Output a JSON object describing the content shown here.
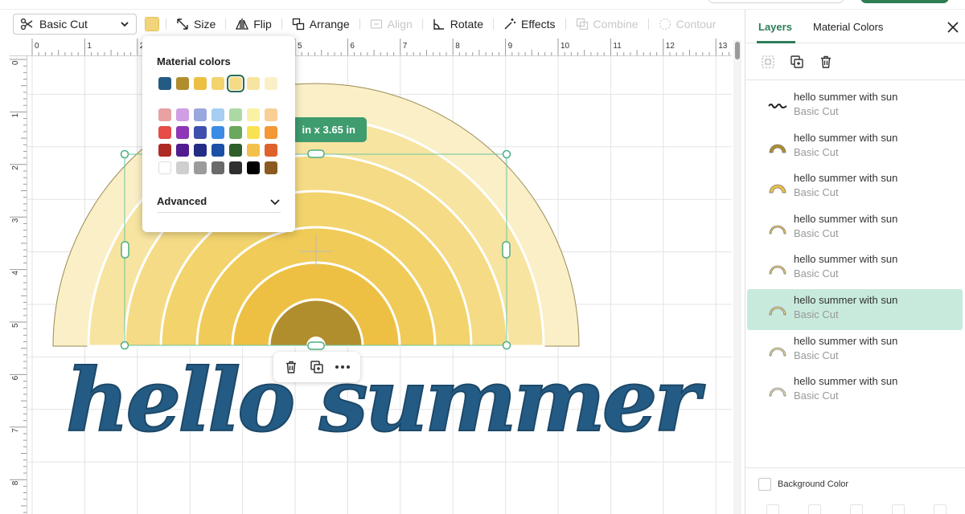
{
  "toolbar": {
    "operation": "Basic Cut",
    "fill_color": "#f2d57a",
    "tools": [
      {
        "label": "Size",
        "icon": "resize-arrows-icon",
        "enabled": true
      },
      {
        "label": "Flip",
        "icon": "flip-icon",
        "enabled": true
      },
      {
        "label": "Arrange",
        "icon": "arrange-icon",
        "enabled": true
      },
      {
        "label": "Align",
        "icon": "align-icon",
        "enabled": false
      },
      {
        "label": "Rotate",
        "icon": "rotate-icon",
        "enabled": true
      },
      {
        "label": "Effects",
        "icon": "magic-wand-icon",
        "enabled": true
      },
      {
        "label": "Combine",
        "icon": "combine-icon",
        "enabled": false
      },
      {
        "label": "Contour",
        "icon": "contour-icon",
        "enabled": false
      }
    ]
  },
  "ruler": {
    "top": [
      "0",
      "1",
      "2",
      "3",
      "4",
      "5",
      "6",
      "7",
      "8",
      "9",
      "10",
      "11",
      "12",
      "13"
    ],
    "left": [
      "0",
      "1",
      "2",
      "3",
      "4",
      "5",
      "6",
      "7",
      "8"
    ]
  },
  "selection": {
    "size_label": "in x 3.65  in"
  },
  "canvas": {
    "text": "hello summer",
    "text_color": "#245b84",
    "arc_colors": [
      "#faefc7",
      "#f7e4a0",
      "#f5db85",
      "#f2d36c",
      "#f0cb58",
      "#edc044",
      "#b18e2d"
    ]
  },
  "color_popover": {
    "title": "Material colors",
    "material_swatches": [
      "#245b84",
      "#b18e2d",
      "#edc044",
      "#f2d36c",
      "#f5db85",
      "#f7e4a0",
      "#faefc7"
    ],
    "selected_index": 4,
    "basic_swatches": [
      "#e8a2a2",
      "#d19ee4",
      "#9aa6de",
      "#a6cdf2",
      "#acd8a4",
      "#fbf1a4",
      "#f9cf95",
      "#e74c48",
      "#8e36b7",
      "#3e4fae",
      "#3a8ce4",
      "#6aa85b",
      "#f9e251",
      "#f49835",
      "#ad2c25",
      "#501c8f",
      "#242c84",
      "#1c4fa7",
      "#2e5f2a",
      "#f3c04a",
      "#e0622b",
      "#ffffff",
      "#cfcfcf",
      "#9b9b9b",
      "#6a6a6a",
      "#2f2f2f",
      "#000000",
      "#8a5a20"
    ],
    "advanced_label": "Advanced"
  },
  "panel": {
    "tabs": [
      "Layers",
      "Material Colors"
    ],
    "active_tab": 0,
    "layers": [
      {
        "name": "hello summer with sun",
        "op": "Basic Cut",
        "thumb": "text"
      },
      {
        "name": "hello summer with sun",
        "op": "Basic Cut",
        "thumb": "#b18e2d"
      },
      {
        "name": "hello summer with sun",
        "op": "Basic Cut",
        "thumb": "#edc044"
      },
      {
        "name": "hello summer with sun",
        "op": "Basic Cut",
        "thumb": "#f0cb58"
      },
      {
        "name": "hello summer with sun",
        "op": "Basic Cut",
        "thumb": "#f2d36c"
      },
      {
        "name": "hello summer with sun",
        "op": "Basic Cut",
        "thumb": "#f5db85"
      },
      {
        "name": "hello summer with sun",
        "op": "Basic Cut",
        "thumb": "#f7e4a0"
      },
      {
        "name": "hello summer with sun",
        "op": "Basic Cut",
        "thumb": "#faefc7"
      }
    ],
    "selected_layer": 5,
    "background_color_label": "Background Color"
  }
}
